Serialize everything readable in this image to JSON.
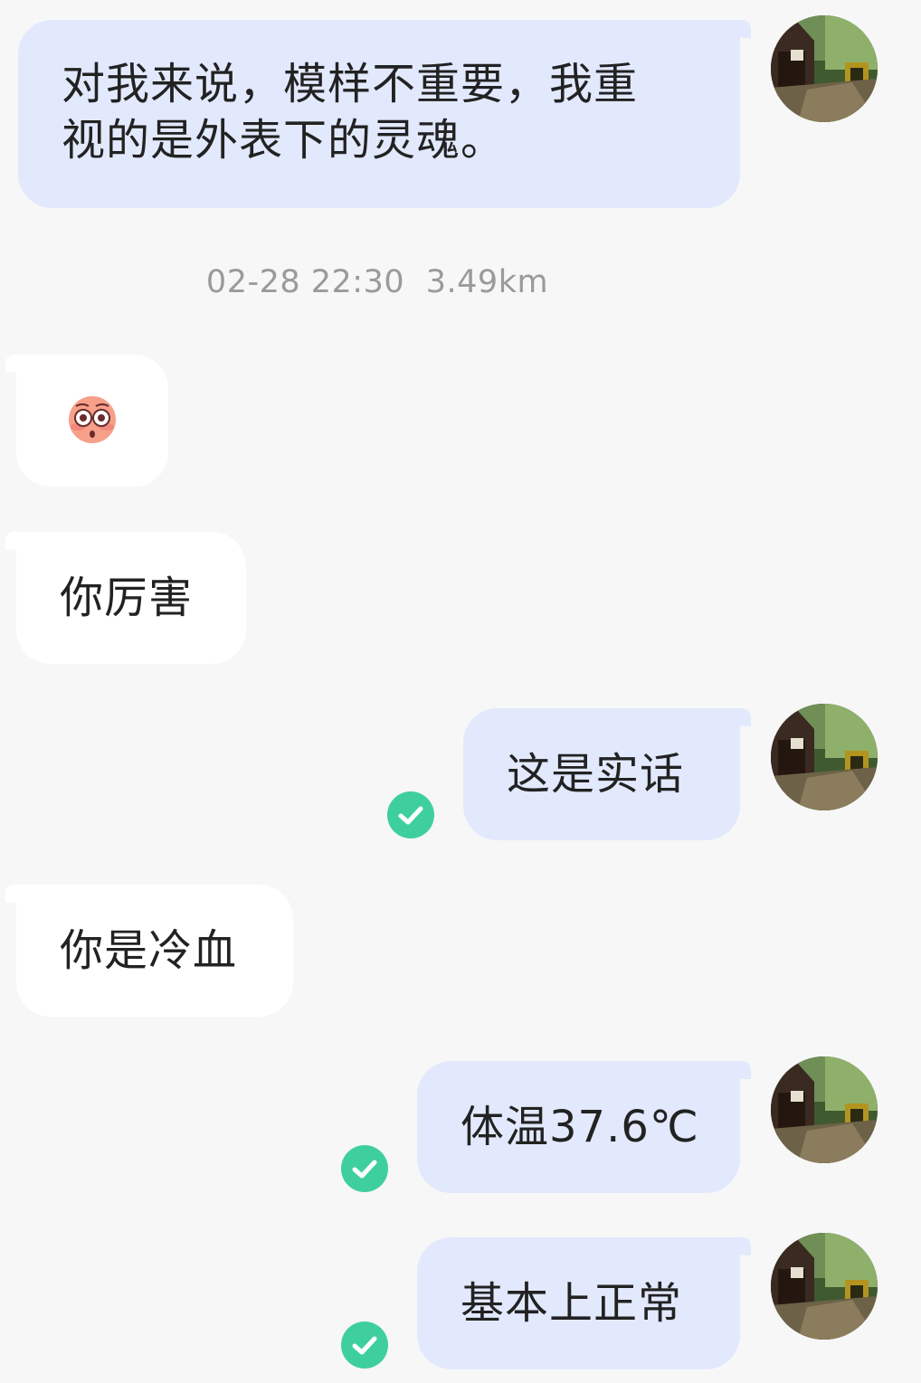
{
  "conversation": {
    "messages": [
      {
        "side": "me",
        "text": "对我来说，模样不重要，我重视的是外表下的灵魂。",
        "line1": "对我来说，模样不重要，我重",
        "line2": "视的是外表下的灵魂。"
      },
      {
        "side": "them",
        "type": "emoji",
        "icon": "flushed-face-emoji"
      },
      {
        "side": "them",
        "text": "你厉害"
      },
      {
        "side": "me",
        "text": "这是实话",
        "status": "read-check"
      },
      {
        "side": "them",
        "text": "你是冷血"
      },
      {
        "side": "me",
        "text": "体温37.6℃",
        "status": "read-check"
      },
      {
        "side": "me",
        "text": "基本上正常",
        "status": "read-check"
      }
    ],
    "meta": {
      "date_time": "02-28 22:30",
      "distance": "3.49km"
    }
  },
  "colors": {
    "background": "#f7f7f7",
    "my_bubble": "#e2e9fd",
    "their_bubble": "#ffffff",
    "check": "#3fcf9f",
    "timestamp": "#9a9a9a"
  }
}
